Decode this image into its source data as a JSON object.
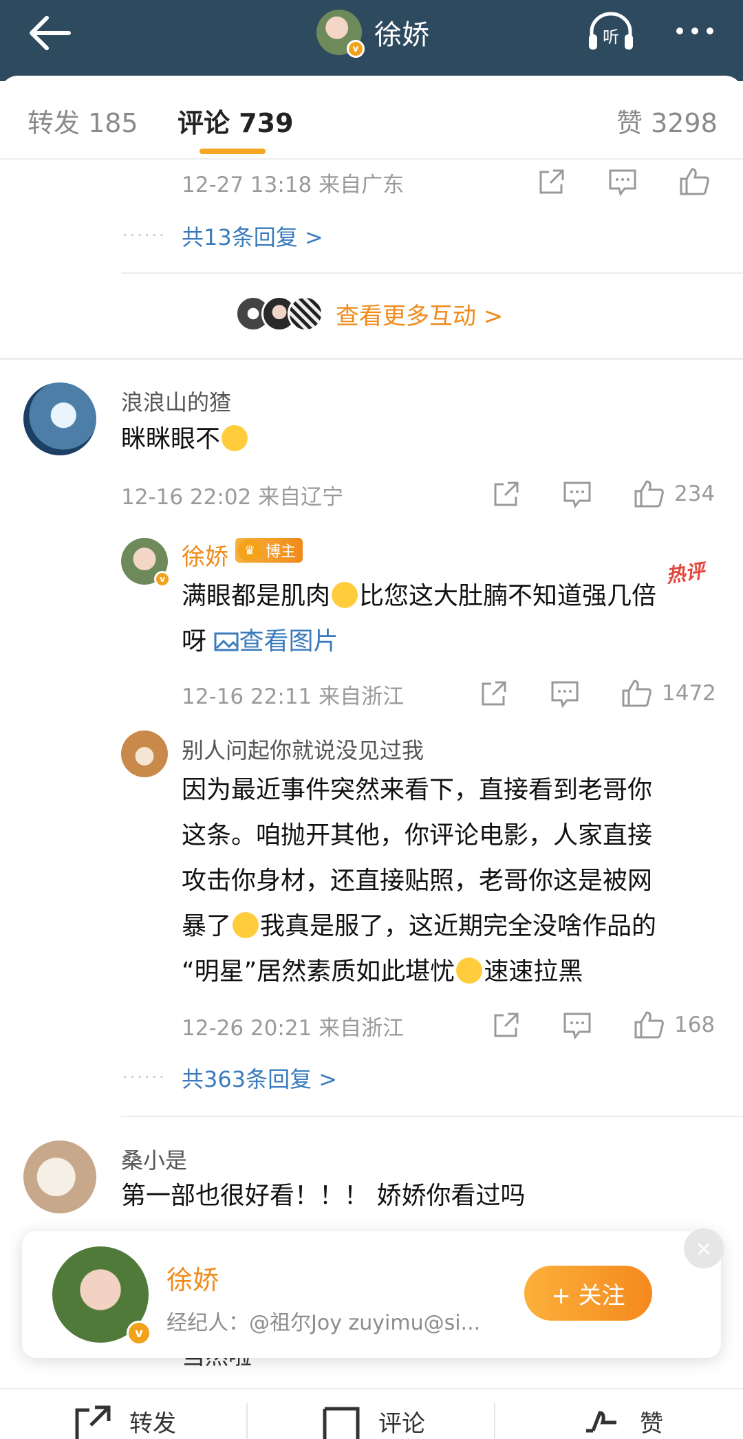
{
  "header": {
    "title": "徐娇"
  },
  "tabs": [
    {
      "label": "转发 185"
    },
    {
      "label": "评论 739"
    },
    {
      "label": "赞 3298"
    }
  ],
  "comment_prev": {
    "time": "12-27 13:18  来自广东",
    "replies": "共13条回复 >"
  },
  "interaction_link": "查看更多互动 >",
  "comments": [
    {
      "user": "浪浪山的猹",
      "text": "眯眯眼不",
      "time": "12-16 22:02  来自辽宁",
      "likes": "234",
      "host_reply": {
        "user": "徐娇",
        "badge": "博主",
        "hot": "热评",
        "text": "满眼都是肌肉",
        "text2": "比您这大肚腩不知道强几倍",
        "text3": "呀 ",
        "image_link": "查看图片",
        "time": "12-16 22:11  来自浙江",
        "likes": "1472"
      },
      "second_reply": {
        "user": "别人问起你就说没见过我",
        "line1": "因为最近事件突然来看下，直接看到老哥你",
        "line2": "这条。咱抛开其他，你评论电影，人家直接",
        "line3": "攻击你身材，还直接贴照，老哥你这是被网",
        "line4a": "暴了",
        "line4b": "我真是服了，这近期完全没啥作品的",
        "line5a": "“明星”居然素质如此堪忧",
        "line5b": "速速拉黑",
        "time": "12-26 20:21  来自浙江",
        "likes": "168"
      },
      "replies": "共363条回复 >"
    },
    {
      "user": "桑小是",
      "text": "第一部也很好看！！！ 娇娇你看过吗"
    }
  ],
  "follow_card": {
    "name": "徐娇",
    "desc": "经纪人：@祖尔Joy  zuyimu@si...",
    "button": "+ 关注",
    "close": "×"
  },
  "ghost_text": "当然啦",
  "bottom": {
    "repost": "转发",
    "comment": "评论",
    "like": "赞"
  },
  "colors": {
    "header_bg": "#2d4a5f",
    "accent": "#f5a623",
    "link": "#3a7bbd"
  }
}
